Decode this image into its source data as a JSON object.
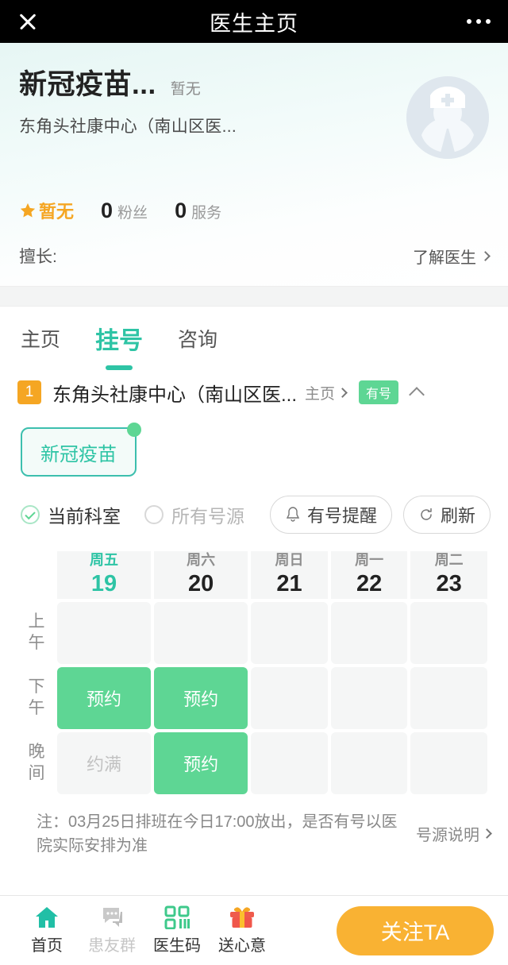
{
  "titlebar": {
    "title": "医生主页",
    "close_icon": "close-icon",
    "more_icon": "more-icon"
  },
  "profile": {
    "name": "新冠疫苗...",
    "title_label": "暂无",
    "hospital": "东角头社康中心（南山区医...",
    "avatar_icon": "doctor-avatar-placeholder",
    "rating": {
      "star_icon": "star-icon",
      "value": "暂无"
    },
    "stats": [
      {
        "num": "0",
        "label": "粉丝"
      },
      {
        "num": "0",
        "label": "服务"
      }
    ],
    "skill_label": "擅长:",
    "skill_value": "",
    "learn_more": "了解医生"
  },
  "tabs": [
    {
      "label": "主页",
      "active": false
    },
    {
      "label": "挂号",
      "active": true
    },
    {
      "label": "咨询",
      "active": false
    }
  ],
  "hospital_row": {
    "index": "1",
    "name": "东角头社康中心（南山区医...",
    "home_link": "主页",
    "status_tag": "有号",
    "collapse_icon": "chevron-up-icon"
  },
  "department": {
    "chip_label": "新冠疫苗",
    "has_dot": true
  },
  "filters": {
    "options": [
      {
        "label": "当前科室",
        "selected": true
      },
      {
        "label": "所有号源",
        "selected": false
      }
    ],
    "buttons": [
      {
        "label": "有号提醒",
        "icon": "bell-icon"
      },
      {
        "label": "刷新",
        "icon": "refresh-icon"
      }
    ]
  },
  "schedule": {
    "days": [
      {
        "dow": "周五",
        "num": "19",
        "today": true
      },
      {
        "dow": "周六",
        "num": "20",
        "today": false
      },
      {
        "dow": "周日",
        "num": "21",
        "today": false
      },
      {
        "dow": "周一",
        "num": "22",
        "today": false
      },
      {
        "dow": "周二",
        "num": "23",
        "today": false
      }
    ],
    "periods": [
      {
        "label_l1": "上",
        "label_l2": "午",
        "cells": [
          {
            "text": "",
            "state": "empty"
          },
          {
            "text": "",
            "state": "empty"
          },
          {
            "text": "",
            "state": "empty"
          },
          {
            "text": "",
            "state": "empty"
          },
          {
            "text": "",
            "state": "empty"
          }
        ]
      },
      {
        "label_l1": "下",
        "label_l2": "午",
        "cells": [
          {
            "text": "预约",
            "state": "open"
          },
          {
            "text": "预约",
            "state": "open"
          },
          {
            "text": "",
            "state": "empty"
          },
          {
            "text": "",
            "state": "empty"
          },
          {
            "text": "",
            "state": "empty"
          }
        ]
      },
      {
        "label_l1": "晚",
        "label_l2": "间",
        "cells": [
          {
            "text": "约满",
            "state": "full"
          },
          {
            "text": "预约",
            "state": "open"
          },
          {
            "text": "",
            "state": "empty"
          },
          {
            "text": "",
            "state": "empty"
          },
          {
            "text": "",
            "state": "empty"
          }
        ]
      }
    ]
  },
  "note": {
    "text": "注：03月25日排班在今日17:00放出，是否有号以医院实际安排为准",
    "link": "号源说明"
  },
  "bottombar": {
    "items": [
      {
        "label": "首页",
        "icon": "home-icon",
        "disabled": false
      },
      {
        "label": "患友群",
        "icon": "chat-group-icon",
        "disabled": true
      },
      {
        "label": "医生码",
        "icon": "qr-code-icon",
        "disabled": false
      },
      {
        "label": "送心意",
        "icon": "gift-icon",
        "disabled": false
      }
    ],
    "follow_button": "关注TA"
  },
  "colors": {
    "accent_teal": "#2ec4a5",
    "slot_green": "#5ed694",
    "orange": "#f9b233",
    "badge_orange": "#f5a623",
    "gray_text": "#8e8e8e"
  }
}
